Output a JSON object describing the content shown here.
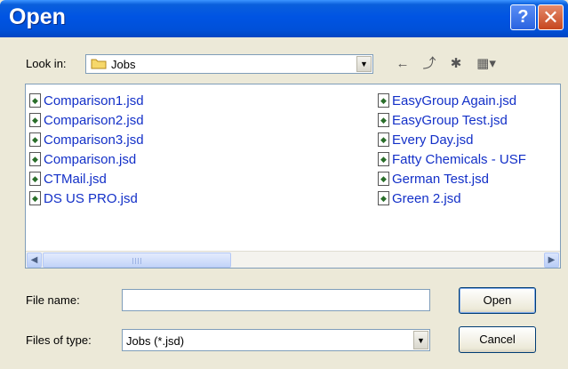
{
  "window": {
    "title": "Open",
    "help_symbol": "?",
    "close_symbol": "✕"
  },
  "lookin": {
    "label": "Look in:",
    "value": "Jobs",
    "dropdown_symbol": "▼"
  },
  "toolbar": {
    "back_symbol": "←",
    "up_symbol": "⤴",
    "newfolder_symbol": "✱",
    "views_symbol": "▦▾"
  },
  "files": {
    "col1": [
      "Comparison1.jsd",
      "Comparison2.jsd",
      "Comparison3.jsd",
      "Comparison.jsd",
      "CTMail.jsd",
      "DS US PRO.jsd"
    ],
    "col2": [
      "EasyGroup Again.jsd",
      "EasyGroup Test.jsd",
      "Every Day.jsd",
      "Fatty Chemicals - USF",
      "German Test.jsd",
      "Green 2.jsd"
    ]
  },
  "scrollbar": {
    "left_symbol": "◀",
    "right_symbol": "▶"
  },
  "form": {
    "filename_label": "File name:",
    "filename_value": "",
    "filetype_label": "Files of type:",
    "filetype_value": "Jobs (*.jsd)",
    "dropdown_symbol": "▼"
  },
  "buttons": {
    "open": "Open",
    "cancel": "Cancel"
  },
  "colors": {
    "titlebar": "#0054e3",
    "dialog_bg": "#ece9d8",
    "file_text": "#1330c8"
  }
}
